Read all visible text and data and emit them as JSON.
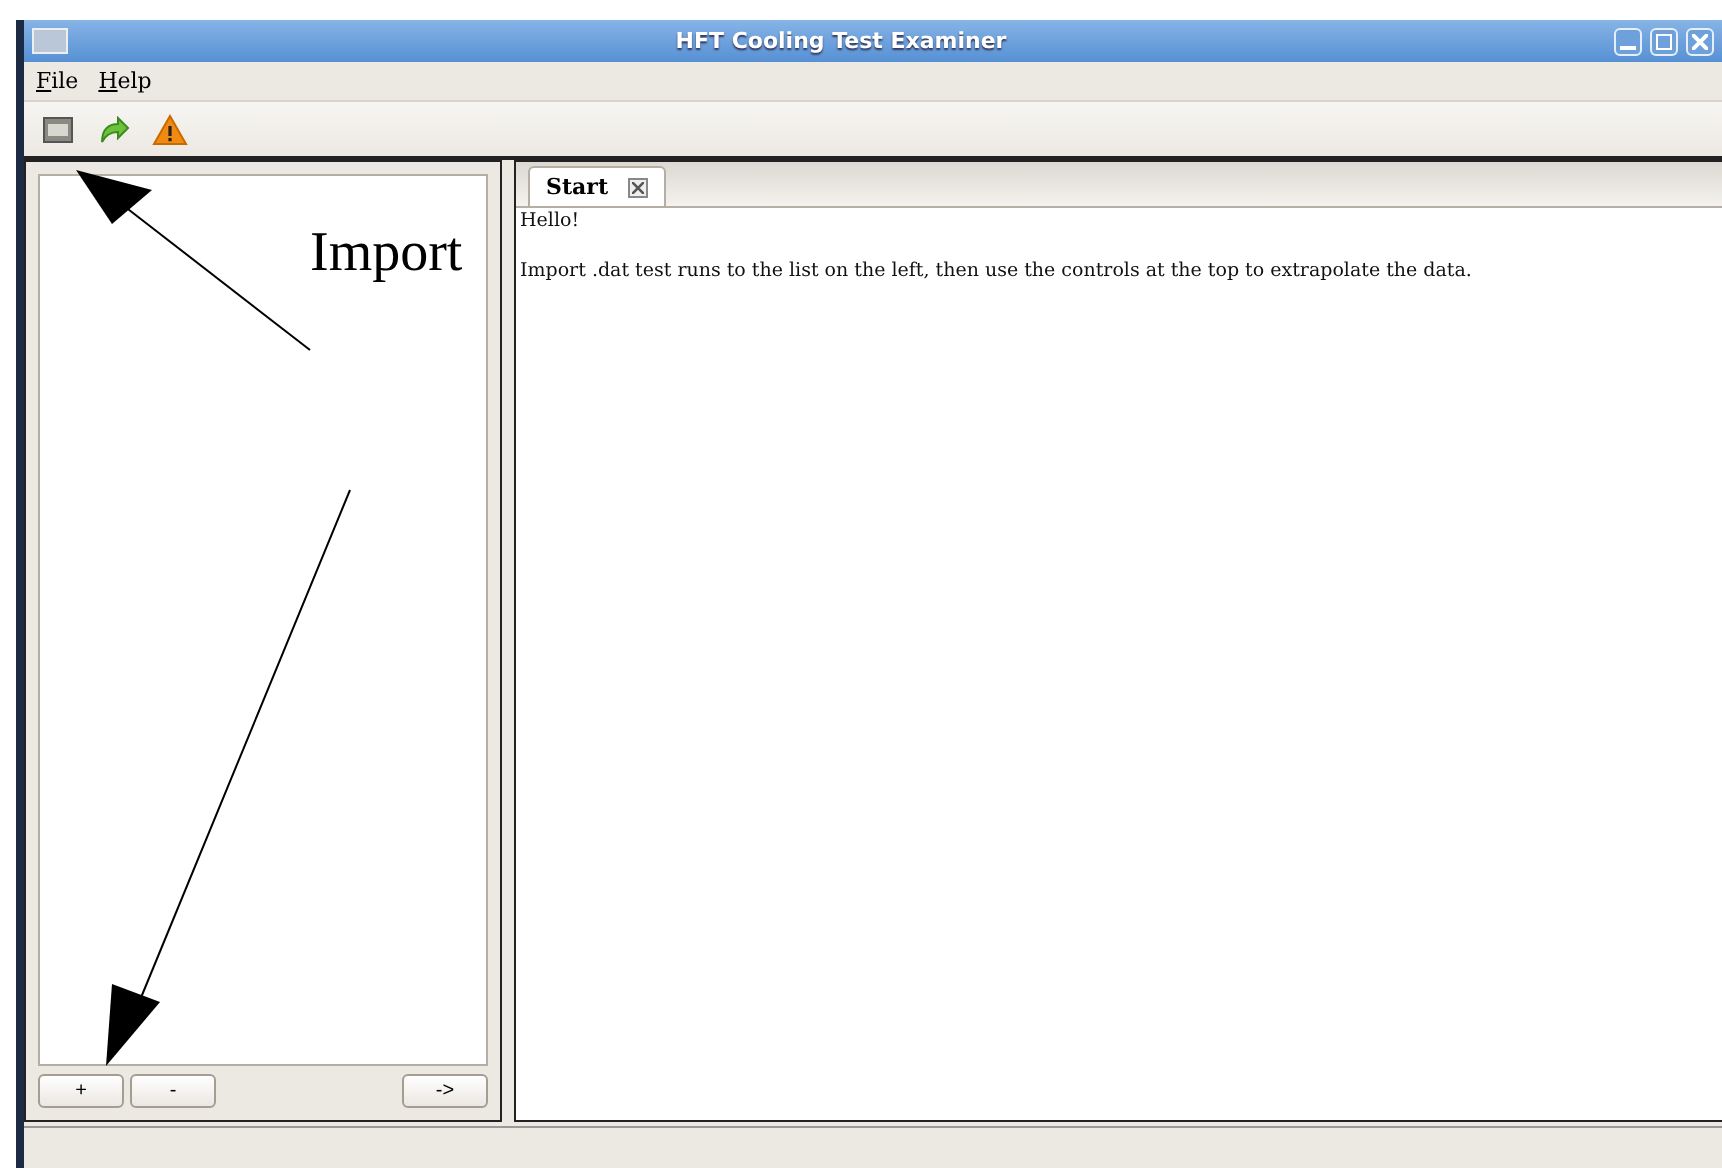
{
  "window": {
    "title": "HFT Cooling Test Examiner"
  },
  "menu": [
    {
      "label": "File"
    },
    {
      "label": "Help"
    }
  ],
  "toolbar": [
    {
      "kind": "open"
    },
    {
      "kind": "redo"
    },
    {
      "kind": "warning"
    }
  ],
  "list_buttons": [
    {
      "label": "+"
    },
    {
      "label": "-"
    },
    {
      "label": "->"
    }
  ],
  "tabs": [
    {
      "label": "Start",
      "selected": true
    }
  ],
  "content": {
    "greeting": "Hello!",
    "message": "Import .dat test runs to the list on the left, then use the controls at the top to extrapolate the data."
  },
  "annotation": {
    "label": "Import"
  }
}
